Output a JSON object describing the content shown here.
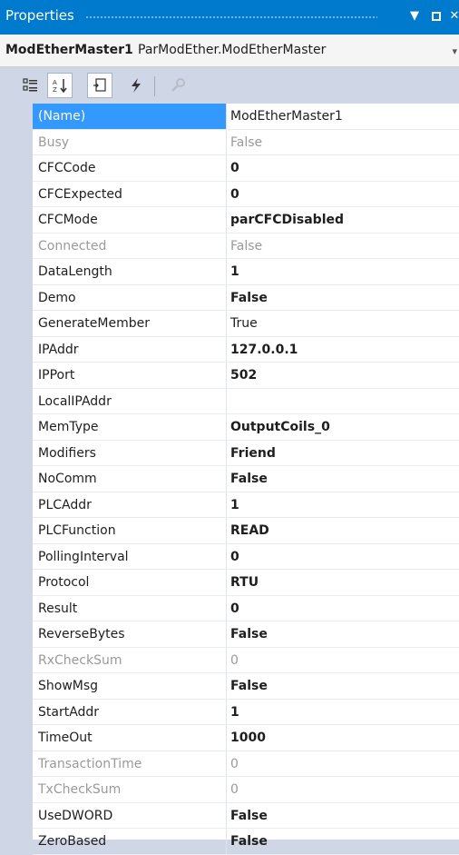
{
  "panel": {
    "title": "Properties",
    "dropdown_icon": "chevron-down-icon",
    "restore_icon": "restore-icon",
    "close_label": "✕"
  },
  "object": {
    "name": "ModEtherMaster1",
    "type": "ParModEther.ModEtherMaster"
  },
  "toolbar": {
    "buttons": [
      "categorized-icon",
      "alphabetical-icon",
      "properties-icon",
      "events-icon",
      "property-pages-icon"
    ]
  },
  "properties": [
    {
      "name": "(Name)",
      "value": "ModEtherMaster1",
      "state": "selected"
    },
    {
      "name": "Busy",
      "value": "False",
      "state": "readonly"
    },
    {
      "name": "CFCCode",
      "value": "0",
      "state": "modified"
    },
    {
      "name": "CFCExpected",
      "value": "0",
      "state": "modified"
    },
    {
      "name": "CFCMode",
      "value": "parCFCDisabled",
      "state": "modified"
    },
    {
      "name": "Connected",
      "value": "False",
      "state": "readonly"
    },
    {
      "name": "DataLength",
      "value": "1",
      "state": "modified"
    },
    {
      "name": "Demo",
      "value": "False",
      "state": "modified"
    },
    {
      "name": "GenerateMember",
      "value": "True",
      "state": "normal"
    },
    {
      "name": "IPAddr",
      "value": "127.0.0.1",
      "state": "modified"
    },
    {
      "name": "IPPort",
      "value": "502",
      "state": "modified"
    },
    {
      "name": "LocalIPAddr",
      "value": "",
      "state": "normal"
    },
    {
      "name": "MemType",
      "value": "OutputCoils_0",
      "state": "modified"
    },
    {
      "name": "Modifiers",
      "value": "Friend",
      "state": "modified"
    },
    {
      "name": "NoComm",
      "value": "False",
      "state": "modified"
    },
    {
      "name": "PLCAddr",
      "value": "1",
      "state": "modified"
    },
    {
      "name": "PLCFunction",
      "value": "READ",
      "state": "modified"
    },
    {
      "name": "PollingInterval",
      "value": "0",
      "state": "modified"
    },
    {
      "name": "Protocol",
      "value": "RTU",
      "state": "modified"
    },
    {
      "name": "Result",
      "value": "0",
      "state": "modified"
    },
    {
      "name": "ReverseBytes",
      "value": "False",
      "state": "modified"
    },
    {
      "name": "RxCheckSum",
      "value": "0",
      "state": "readonly"
    },
    {
      "name": "ShowMsg",
      "value": "False",
      "state": "modified"
    },
    {
      "name": "StartAddr",
      "value": "1",
      "state": "modified"
    },
    {
      "name": "TimeOut",
      "value": "1000",
      "state": "modified"
    },
    {
      "name": "TransactionTime",
      "value": "0",
      "state": "readonly"
    },
    {
      "name": "TxCheckSum",
      "value": "0",
      "state": "readonly"
    },
    {
      "name": "UseDWORD",
      "value": "False",
      "state": "modified"
    },
    {
      "name": "ZeroBased",
      "value": "False",
      "state": "modified"
    }
  ],
  "colors": {
    "title_bar": "#007acc",
    "selection": "#3399ff",
    "readonly_text": "#9a9a9a"
  }
}
